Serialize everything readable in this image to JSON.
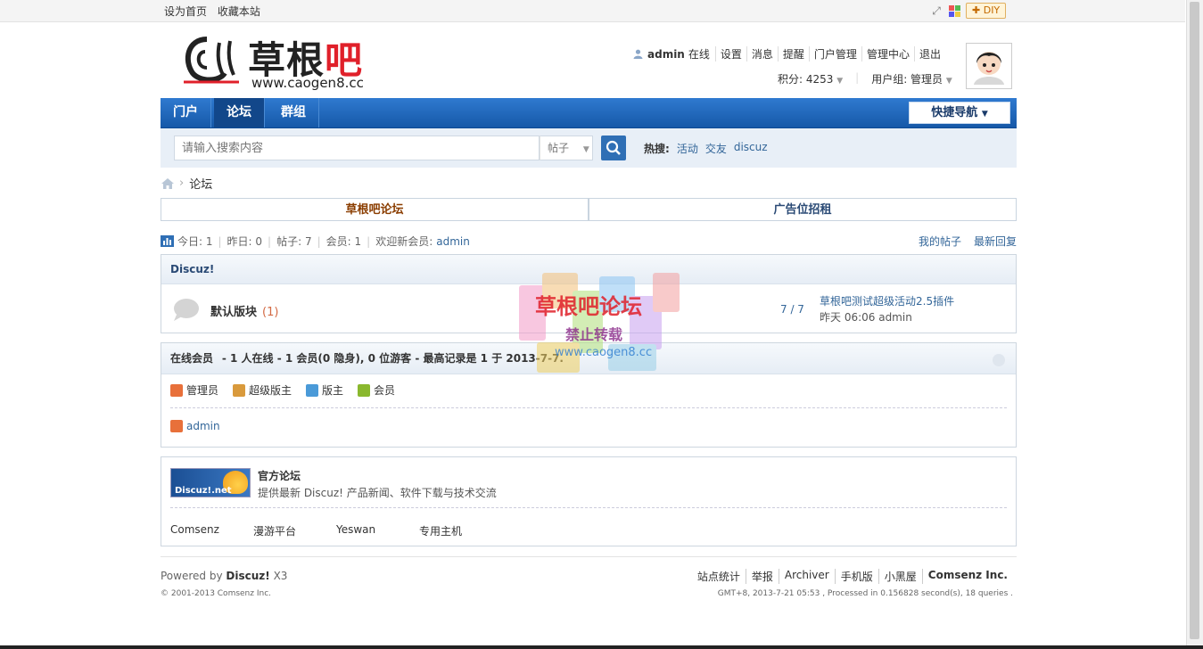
{
  "topbar": {
    "set_home": "设为首页",
    "bookmark": "收藏本站",
    "diy": "DIY"
  },
  "logo": {
    "brand_a": "草根",
    "brand_b": "吧",
    "site": "www.caogen8.cc"
  },
  "user": {
    "name": "admin",
    "status": "在线",
    "links": [
      "设置",
      "消息",
      "提醒",
      "门户管理",
      "管理中心",
      "退出"
    ],
    "points": "积分: 4253",
    "group": "用户组: 管理员"
  },
  "nav": {
    "tabs": [
      "门户",
      "论坛",
      "群组"
    ],
    "quick": "快捷导航"
  },
  "search": {
    "placeholder": "请输入搜索内容",
    "type": "帖子",
    "hot_label": "热搜:",
    "hot": [
      "活动",
      "交友",
      "discuz"
    ]
  },
  "breadcrumb": {
    "current": "论坛"
  },
  "header_tabs": [
    "草根吧论坛",
    "广告位招租"
  ],
  "stats": {
    "today": "今日: 1",
    "yesterday": "昨日: 0",
    "posts": "帖子: 7",
    "members": "会员: 1",
    "welcome": "欢迎新会员:",
    "new_member": "admin",
    "my_posts": "我的帖子",
    "latest": "最新回复"
  },
  "category": {
    "name": "Discuz!",
    "forum": {
      "name": "默认版块",
      "count": "(1)",
      "posts": "7 / 7",
      "last_title": "草根吧测试超级活动2.5插件",
      "last_when": "昨天 06:06 admin"
    }
  },
  "online": {
    "title": "在线会员",
    "summary": "- 1 人在线 - 1 会员(0 隐身), 0 位游客 - 最高记录是 1 于 2013-7-7.",
    "legend": [
      "管理员",
      "超级版主",
      "版主",
      "会员"
    ],
    "user": "admin",
    "colors": {
      "admin": "#e8703a",
      "super": "#d99a3c",
      "mod": "#4a9ad8",
      "member": "#8ab82e"
    }
  },
  "links": {
    "banner": "Discuz!.net",
    "title": "官方论坛",
    "desc": "提供最新 Discuz! 产品新闻、软件下载与技术交流",
    "items": [
      "Comsenz",
      "漫游平台",
      "Yeswan",
      "专用主机"
    ]
  },
  "footer": {
    "powered_prefix": "Powered by",
    "powered_name": "Discuz!",
    "powered_ver": "X3",
    "copyright": "© 2001-2013 Comsenz Inc.",
    "links": [
      "站点统计",
      "举报",
      "Archiver",
      "手机版",
      "小黑屋",
      "Comsenz Inc."
    ],
    "gmt": "GMT+8, 2013-7-21 05:53 , Processed in 0.156828 second(s), 18 queries ."
  },
  "watermark": {
    "title": "草根吧论坛",
    "sub": "禁止转载",
    "url": "www.caogen8.cc"
  },
  "theme": {
    "nav_blue": "#1659a8",
    "link_blue": "#336699",
    "brand_red": "#e0202a"
  }
}
